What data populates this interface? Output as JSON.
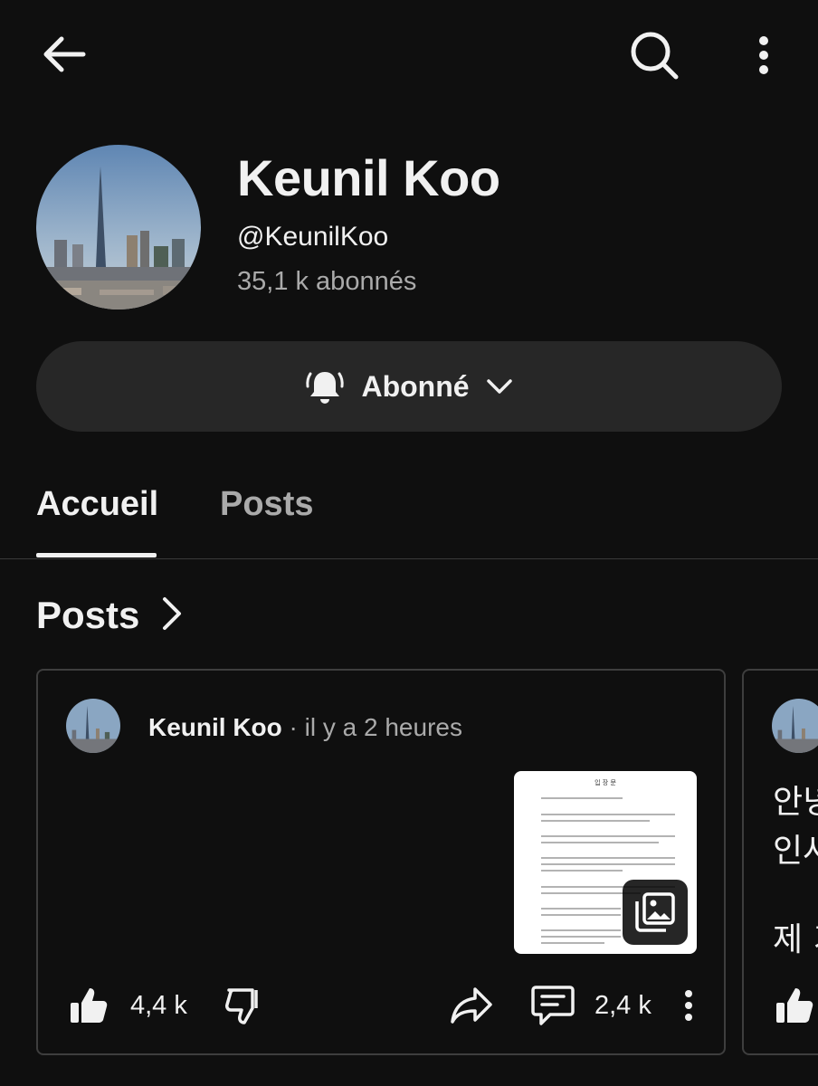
{
  "top_bar": {
    "back_icon": "arrow-left-icon",
    "search_icon": "search-icon",
    "menu_icon": "more-vertical-icon"
  },
  "channel": {
    "name": "Keunil Koo",
    "handle": "@KeunilKoo",
    "subscribers": "35,1 k abonnés",
    "avatar_icon": "city-skyline-avatar"
  },
  "subscribe_button": {
    "label": "Abonné",
    "bell_icon": "bell-ringing-icon",
    "chevron_icon": "chevron-down-icon"
  },
  "tabs": [
    {
      "label": "Accueil",
      "active": true
    },
    {
      "label": "Posts",
      "active": false
    }
  ],
  "section": {
    "title": "Posts",
    "chevron_icon": "chevron-right-icon"
  },
  "post": {
    "author": "Keunil Koo",
    "time": " · il y a 2 heures",
    "thumbnail_title": "입 장 문",
    "likes": "4,4 k",
    "comments": "2,4 k",
    "like_icon": "thumb-up-icon",
    "dislike_icon": "thumb-down-icon",
    "share_icon": "share-icon",
    "comment_icon": "comment-icon",
    "more_icon": "more-vertical-icon",
    "gallery_icon": "image-gallery-icon"
  },
  "next_post": {
    "text_lines": [
      "안녕",
      "인사",
      "제 기"
    ]
  },
  "colors": {
    "background": "#0f0f0f",
    "surface": "#272727",
    "text_primary": "#f1f1f1",
    "text_secondary": "#aaaaaa",
    "border": "#3e3e3e"
  }
}
